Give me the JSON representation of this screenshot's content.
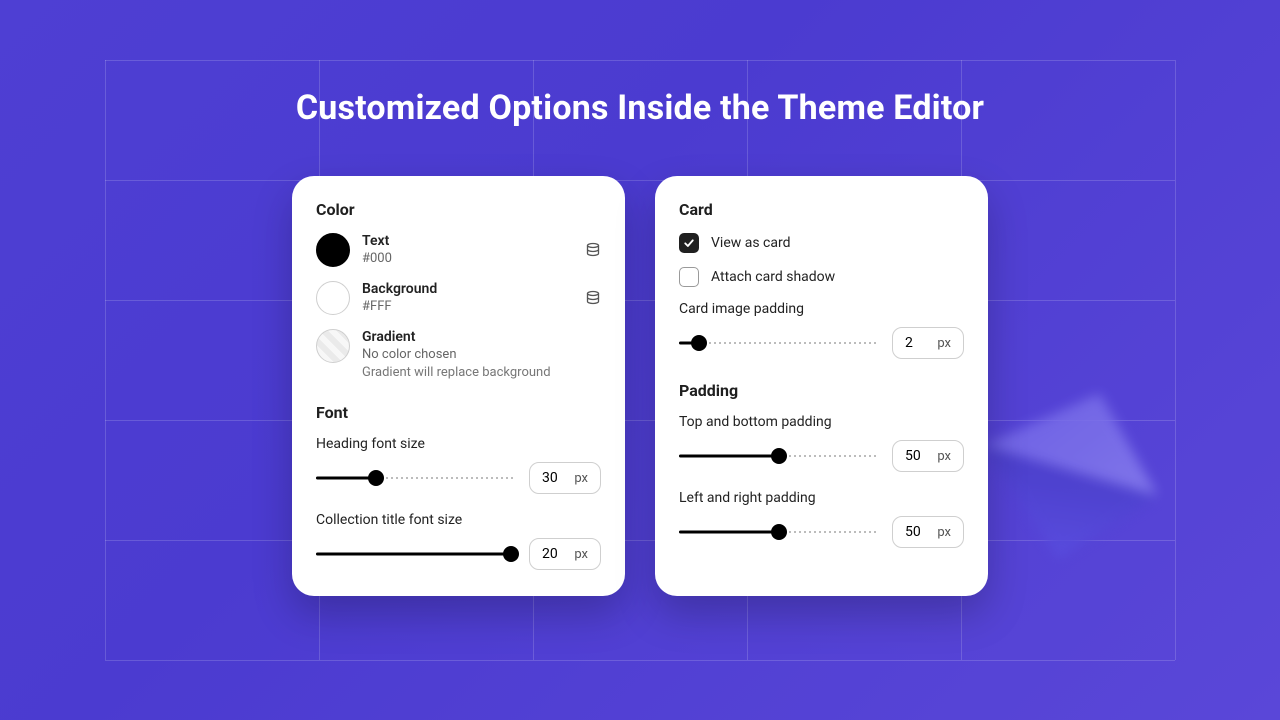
{
  "title": "Customized Options Inside the Theme Editor",
  "left": {
    "color": {
      "heading": "Color",
      "text": {
        "label": "Text",
        "value": "#000"
      },
      "background": {
        "label": "Background",
        "value": "#FFF"
      },
      "gradient": {
        "label": "Gradient",
        "value": "No color chosen",
        "note": "Gradient will replace background"
      }
    },
    "font": {
      "heading": "Font",
      "heading_size": {
        "label": "Heading font size",
        "value": "30",
        "unit": "px",
        "percent": 30
      },
      "collection_size": {
        "label": "Collection title font size",
        "value": "20",
        "unit": "px",
        "percent": 98
      }
    }
  },
  "right": {
    "card": {
      "heading": "Card",
      "view_as_card": {
        "label": "View as card",
        "checked": true
      },
      "attach_shadow": {
        "label": "Attach card shadow",
        "checked": false
      },
      "image_padding": {
        "label": "Card image padding",
        "value": "2",
        "unit": "px",
        "percent": 10
      }
    },
    "padding": {
      "heading": "Padding",
      "top_bottom": {
        "label": "Top and bottom padding",
        "value": "50",
        "unit": "px",
        "percent": 50
      },
      "left_right": {
        "label": "Left and right padding",
        "value": "50",
        "unit": "px",
        "percent": 50
      }
    }
  }
}
